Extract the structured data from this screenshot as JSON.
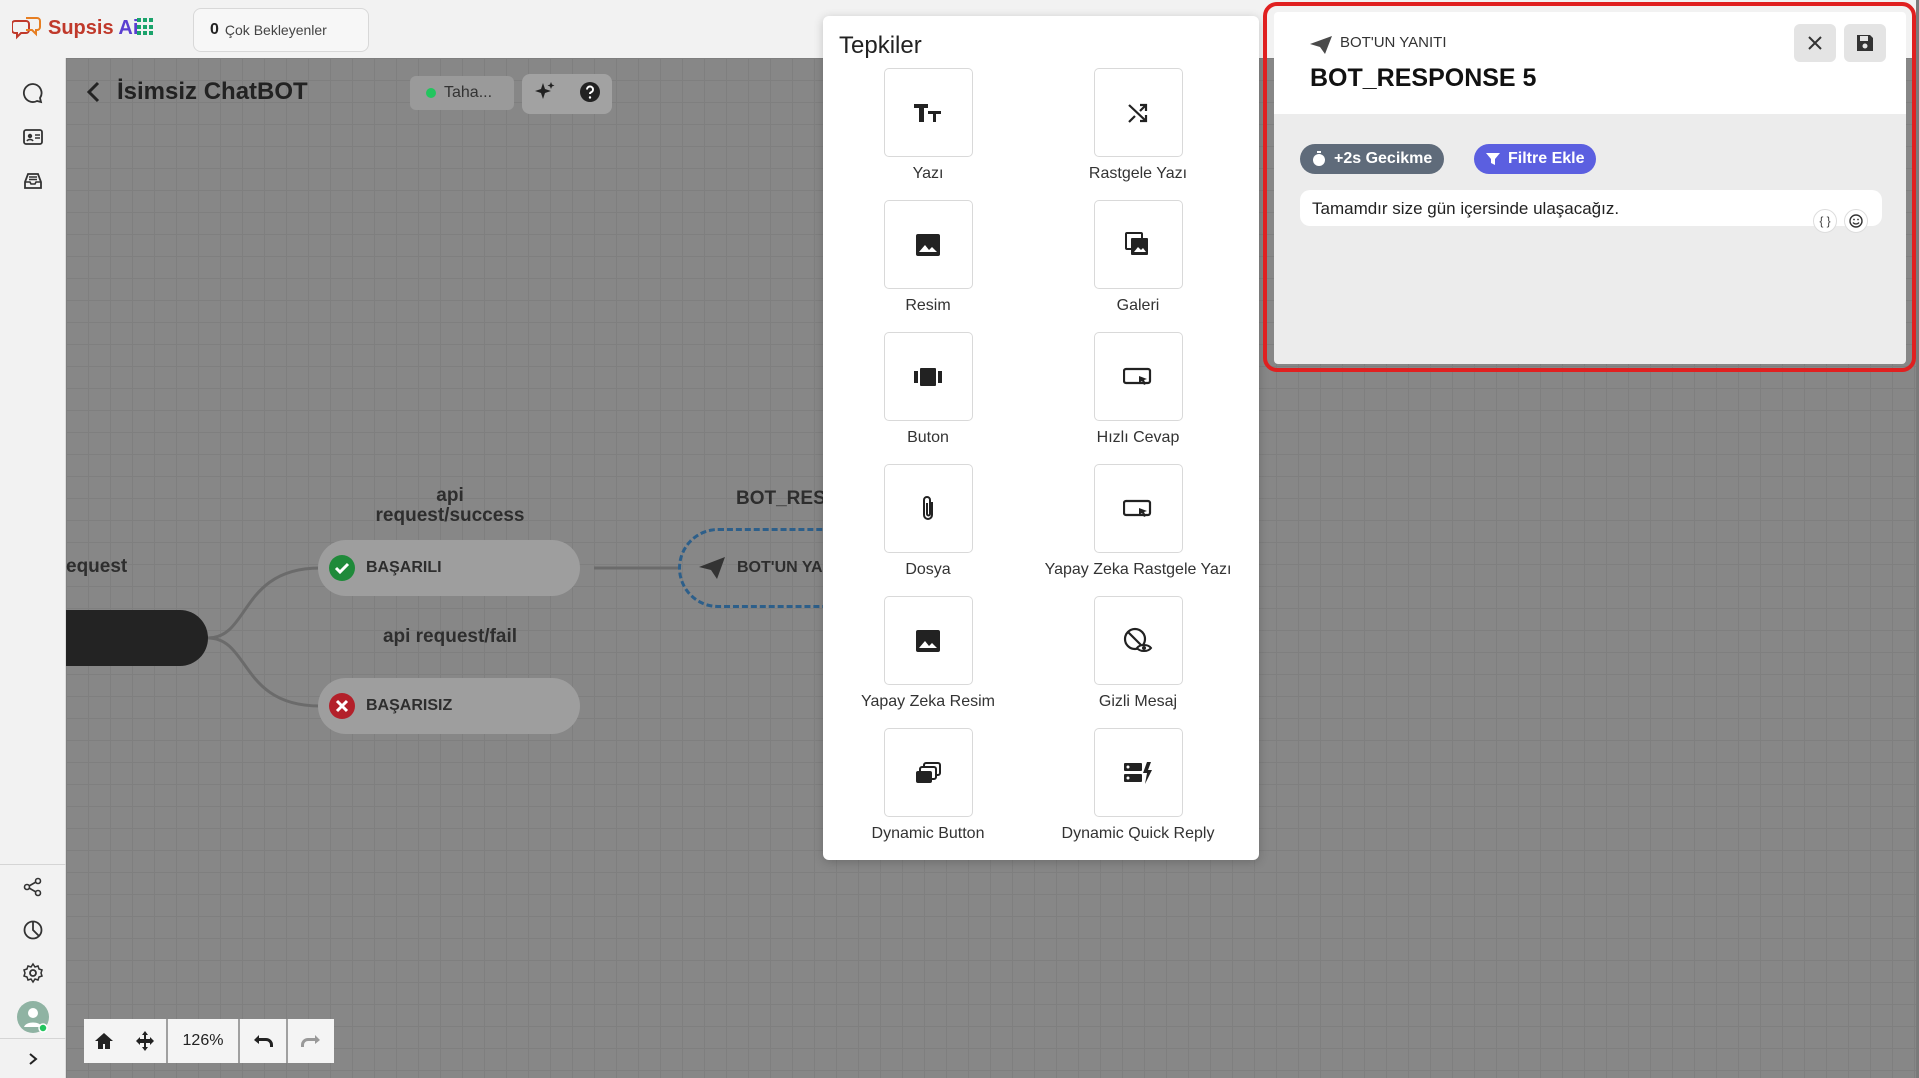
{
  "app": {
    "logo_text": "Supsis",
    "logo_ai": "Ai"
  },
  "waiting": {
    "count": "0",
    "label": "Çok Bekleyenler"
  },
  "canvas": {
    "bot_title": "İsimsiz ChatBOT",
    "user_name": "Taha...",
    "labels": {
      "request": "equest",
      "api_success": "api\nrequest/success",
      "api_fail": "api request/fail",
      "bot_res": "BOT_RES"
    },
    "nodes": {
      "success": "BAŞARILI",
      "fail": "BAŞARISIZ",
      "bot": "BOT'UN YA"
    },
    "zoom": "126%"
  },
  "reactions": {
    "title": "Tepkiler",
    "items": [
      {
        "label": "Yazı",
        "icon": "text-size-icon"
      },
      {
        "label": "Rastgele Yazı",
        "icon": "shuffle-icon"
      },
      {
        "label": "Resim",
        "icon": "image-icon"
      },
      {
        "label": "Galeri",
        "icon": "gallery-icon"
      },
      {
        "label": "Buton",
        "icon": "button-carousel-icon"
      },
      {
        "label": "Hızlı Cevap",
        "icon": "quick-reply-icon"
      },
      {
        "label": "Dosya",
        "icon": "paperclip-icon"
      },
      {
        "label": "Yapay Zeka Rastgele Yazı",
        "icon": "ai-quick-reply-icon"
      },
      {
        "label": "Yapay Zeka Resim",
        "icon": "ai-image-icon"
      },
      {
        "label": "Gizli Mesaj",
        "icon": "hidden-message-icon"
      },
      {
        "label": "Dynamic Button",
        "icon": "dynamic-button-icon"
      },
      {
        "label": "Dynamic Quick Reply",
        "icon": "dynamic-quick-reply-icon"
      }
    ]
  },
  "editor": {
    "subtitle": "BOT'UN YANITI",
    "title": "BOT_RESPONSE 5",
    "delay_badge": "+2s Gecikme",
    "filter_badge": "Filtre Ekle",
    "message": "Tamamdır size gün içersinde ulaşacağız.",
    "highlight_color": "#e02020"
  }
}
